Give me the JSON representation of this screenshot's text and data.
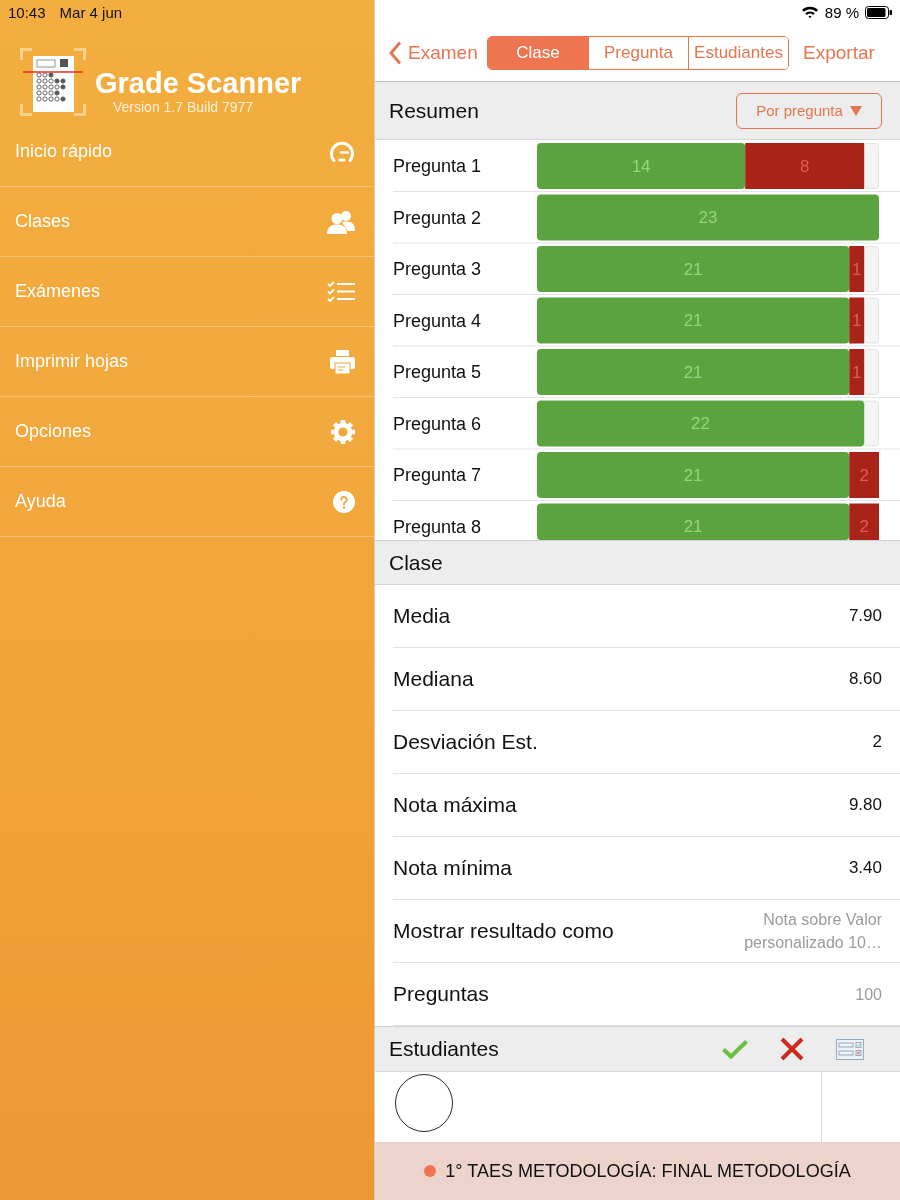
{
  "status_bar": {
    "time": "10:43",
    "date": "Mar 4 jun",
    "battery": "89 %"
  },
  "sidebar": {
    "app_title": "Grade Scanner",
    "version": "Version 1.7 Build 7977",
    "items": [
      {
        "label": "Inicio rápido",
        "selected": false
      },
      {
        "label": "Clases",
        "selected": false
      },
      {
        "label": "Exámenes",
        "selected": false
      },
      {
        "label": "Imprimir hojas",
        "selected": false
      },
      {
        "label": "Opciones",
        "selected": false
      },
      {
        "label": "Ayuda",
        "selected": false
      }
    ]
  },
  "nav": {
    "back": "Examen",
    "segments": [
      {
        "label": "Clase",
        "selected": true
      },
      {
        "label": "Pregunta",
        "selected": false
      },
      {
        "label": "Estudiantes",
        "selected": false
      }
    ],
    "action": "Exportar"
  },
  "summary": {
    "title": "Resumen",
    "filter": "Por pregunta",
    "chart_data": {
      "type": "bar",
      "orientation": "horizontal",
      "stacked": true,
      "categories": [
        "Pregunta 1",
        "Pregunta 2",
        "Pregunta 3",
        "Pregunta 4",
        "Pregunta 5",
        "Pregunta 6",
        "Pregunta 7",
        "Pregunta 8"
      ],
      "series": [
        {
          "color": "#5aa33f",
          "values": [
            14,
            23,
            21,
            21,
            21,
            22,
            21,
            21
          ]
        },
        {
          "color": "#a82318",
          "values": [
            8,
            null,
            1,
            1,
            1,
            null,
            2,
            2
          ]
        }
      ],
      "data_labels": true
    }
  },
  "class_stats": {
    "title": "Clase",
    "rows": [
      {
        "label": "Media",
        "value": "7.90",
        "kind": "stat"
      },
      {
        "label": "Mediana",
        "value": "8.60",
        "kind": "stat"
      },
      {
        "label": "Desviación Est.",
        "value": "2",
        "kind": "stat"
      },
      {
        "label": "Nota máxima",
        "value": "9.80",
        "kind": "stat"
      },
      {
        "label": "Nota mínima",
        "value": "3.40",
        "kind": "stat"
      },
      {
        "label": "Mostrar resultado como",
        "value": "Nota sobre Valor personalizado 10…",
        "kind": "setting"
      },
      {
        "label": "Preguntas",
        "value": "100",
        "kind": "setting"
      }
    ]
  },
  "students": {
    "title": "Estudiantes"
  },
  "footer": {
    "title": "1° TAES METODOLOGÍA: FINAL METODOLOGÍA"
  }
}
